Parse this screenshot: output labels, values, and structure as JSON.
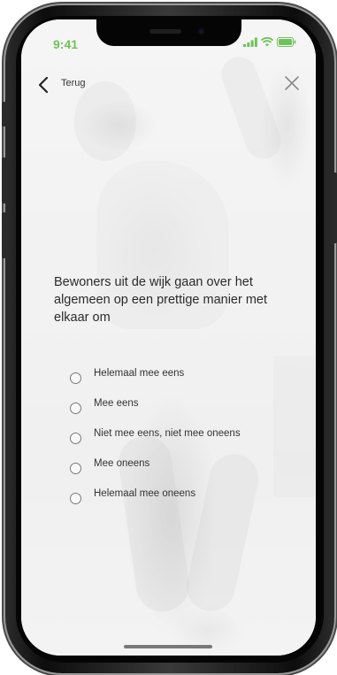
{
  "status_bar": {
    "time": "9:41",
    "accent_color": "#6fc35a"
  },
  "nav": {
    "back_label": "Terug",
    "back_icon": "chevron-left-icon",
    "close_icon": "close-icon"
  },
  "question": {
    "text": "Bewoners uit de wijk gaan over het algemeen op een prettige manier met elkaar om"
  },
  "options": [
    {
      "label": "Helemaal mee eens"
    },
    {
      "label": "Mee eens"
    },
    {
      "label": "Niet mee eens, niet mee oneens"
    },
    {
      "label": "Mee oneens"
    },
    {
      "label": "Helemaal mee oneens"
    }
  ]
}
